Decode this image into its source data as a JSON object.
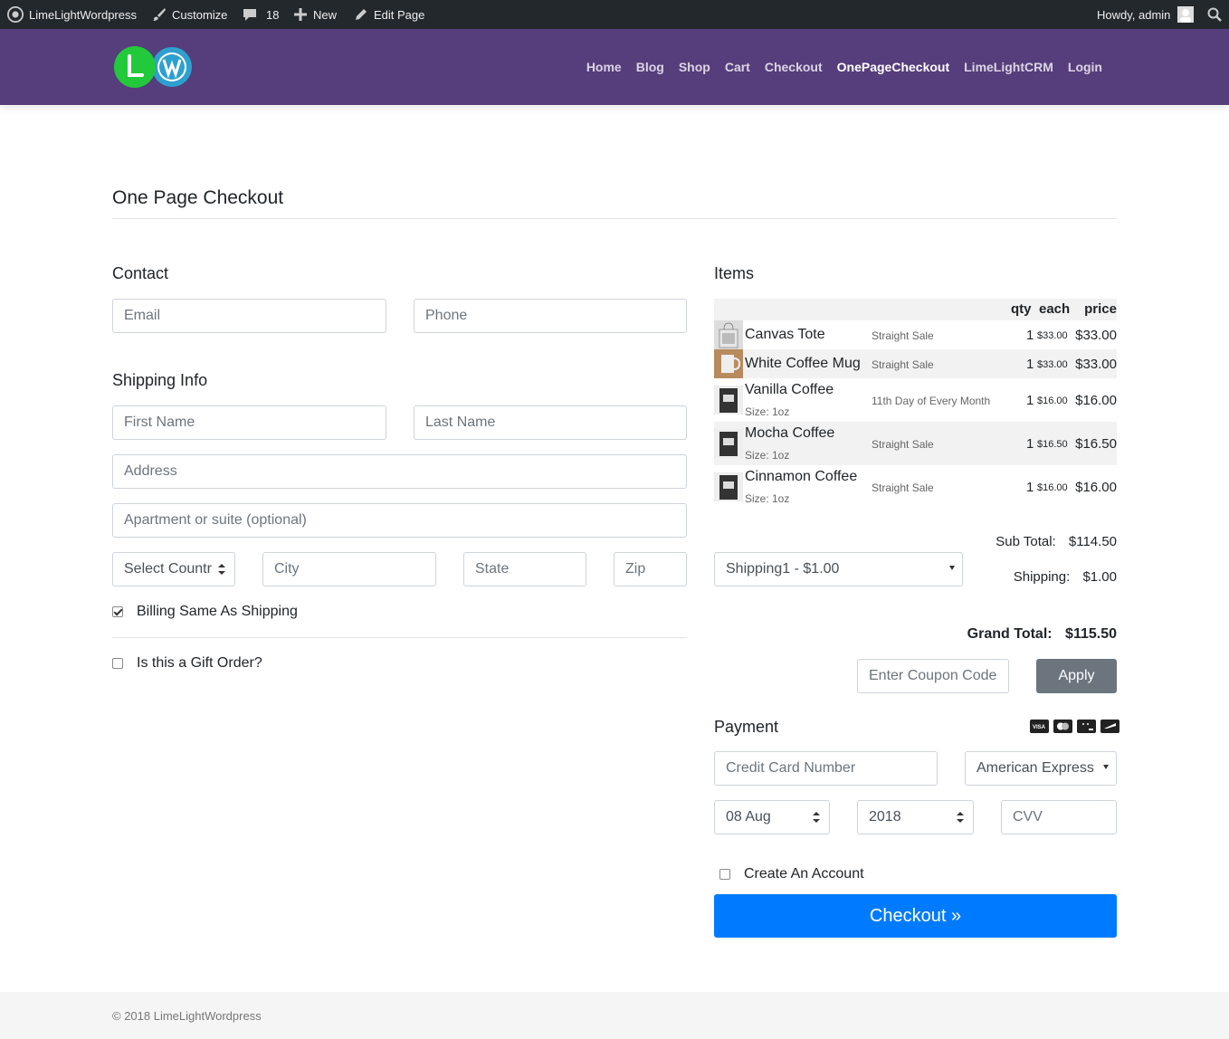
{
  "adminbar": {
    "site_name": "LimeLightWordpress",
    "customize": "Customize",
    "comments_count": "18",
    "new_label": "New",
    "edit_page": "Edit Page",
    "howdy": "Howdy, admin"
  },
  "nav": {
    "items": [
      "Home",
      "Blog",
      "Shop",
      "Cart",
      "Checkout",
      "OnePageCheckout",
      "LimeLightCRM",
      "Login"
    ],
    "active": "OnePageCheckout"
  },
  "page": {
    "title": "One Page Checkout"
  },
  "contact": {
    "heading": "Contact",
    "email_placeholder": "Email",
    "phone_placeholder": "Phone"
  },
  "shipping": {
    "heading": "Shipping Info",
    "first_name_placeholder": "First Name",
    "last_name_placeholder": "Last Name",
    "address_placeholder": "Address",
    "apartment_placeholder": "Apartment or suite (optional)",
    "country_value": "Select Countr",
    "city_placeholder": "City",
    "state_placeholder": "State",
    "zip_placeholder": "Zip",
    "billing_same_label": "Billing Same As Shipping",
    "billing_same_checked": true,
    "gift_label": "Is this a Gift Order?",
    "gift_checked": false
  },
  "items": {
    "heading": "Items",
    "columns": {
      "qty": "qty",
      "each": "each",
      "price": "price"
    },
    "rows": [
      {
        "name": "Canvas Tote",
        "size": "",
        "type": "Straight Sale",
        "qty": "1",
        "each": "$33.00",
        "price": "$33.00"
      },
      {
        "name": "White Coffee Mug",
        "size": "",
        "type": "Straight Sale",
        "qty": "1",
        "each": "$33.00",
        "price": "$33.00"
      },
      {
        "name": "Vanilla Coffee",
        "size": "Size: 1oz",
        "type": "11th Day of Every Month",
        "qty": "1",
        "each": "$16.00",
        "price": "$16.00"
      },
      {
        "name": "Mocha Coffee",
        "size": "Size: 1oz",
        "type": "Straight Sale",
        "qty": "1",
        "each": "$16.50",
        "price": "$16.50"
      },
      {
        "name": "Cinnamon Coffee",
        "size": "Size: 1oz",
        "type": "Straight Sale",
        "qty": "1",
        "each": "$16.00",
        "price": "$16.00"
      }
    ]
  },
  "totals": {
    "subtotal_label": "Sub Total:",
    "subtotal_value": "$114.50",
    "shipping_select": "Shipping1 - $1.00",
    "shipping_label": "Shipping:",
    "shipping_value": "$1.00",
    "grand_label": "Grand Total:",
    "grand_value": "$115.50",
    "coupon_placeholder": "Enter Coupon Code",
    "apply_label": "Apply"
  },
  "payment": {
    "heading": "Payment",
    "card_icons": [
      "visa-icon",
      "mastercard-icon",
      "discover-icon",
      "amex-icon"
    ],
    "cc_placeholder": "Credit Card Number",
    "card_type_value": "American Express",
    "month_value": "08 Aug",
    "year_value": "2018",
    "cvv_placeholder": "CVV",
    "create_account_label": "Create An Account",
    "create_account_checked": false,
    "checkout_label": "Checkout »"
  },
  "footer": {
    "copyright": "© 2018 LimeLightWordpress"
  },
  "colors": {
    "adminbar_bg": "#23282d",
    "navbar_bg": "#563d7c",
    "primary": "#007bff",
    "secondary": "#6c757d"
  }
}
